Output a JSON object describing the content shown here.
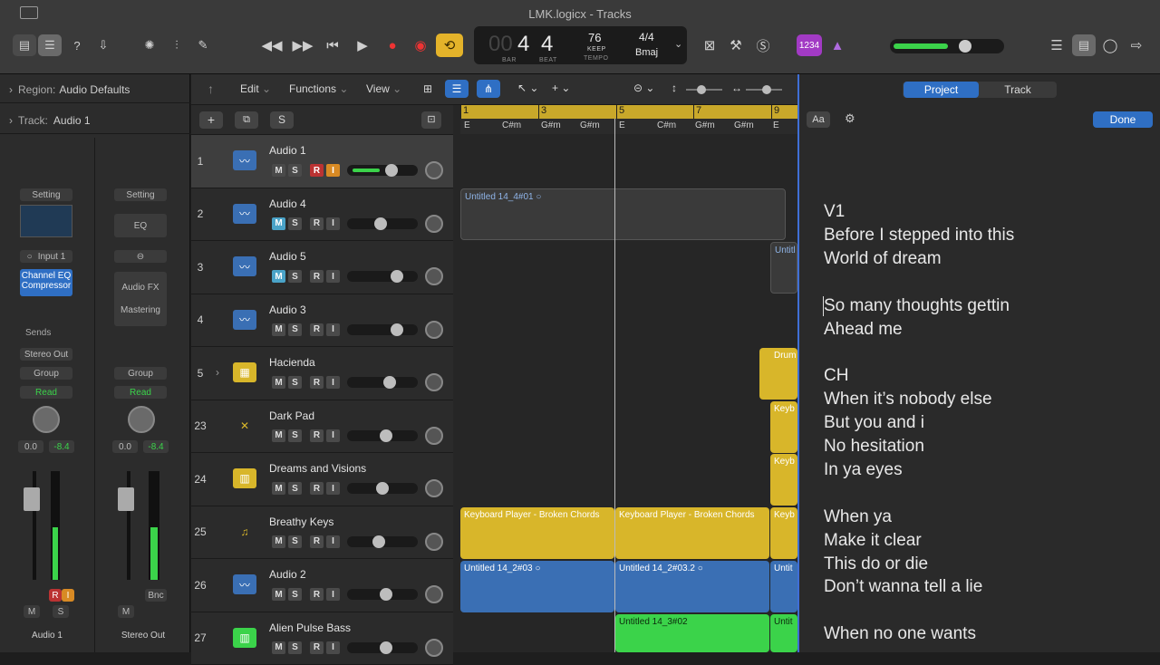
{
  "window": {
    "title": "LMK.logicx - Tracks"
  },
  "lcd": {
    "bar": "4",
    "beat": "4",
    "bar_label": "BAR",
    "beat_label": "BEAT",
    "tempo": "76",
    "keep_label": "KEEP",
    "tempo_label": "TEMPO",
    "signature": "4/4",
    "key": "Bmaj",
    "prefix": "00"
  },
  "toolbar": {
    "count_in": "1234"
  },
  "inspector": {
    "region_label": "Region:",
    "region_value": "Audio Defaults",
    "track_label": "Track:",
    "track_value": "Audio 1",
    "strip1": {
      "setting": "Setting",
      "input": "Input 1",
      "plugin1": "Channel EQ",
      "plugin2": "Compressor",
      "sends": "Sends",
      "output": "Stereo Out",
      "group": "Group",
      "automation": "Read",
      "vol": "0.0",
      "peak": "-8.4",
      "name": "Audio 1",
      "m": "M",
      "s": "S",
      "r": "R",
      "i": "I"
    },
    "strip2": {
      "setting": "Setting",
      "eq": "EQ",
      "fx": "Audio FX",
      "mastering": "Mastering",
      "group": "Group",
      "automation": "Read",
      "vol": "0.0",
      "peak": "-8.4",
      "name": "Stereo Out",
      "m": "M",
      "bnc": "Bnc"
    }
  },
  "arrange_toolbar": {
    "edit": "Edit",
    "functions": "Functions",
    "view": "View",
    "s_btn": "S"
  },
  "ruler": {
    "bars": [
      "1",
      "3",
      "5",
      "7",
      "9"
    ],
    "chords": [
      "E",
      "C#m",
      "G#m",
      "G#m",
      "E",
      "C#m",
      "G#m",
      "G#m",
      "E"
    ]
  },
  "tracks": [
    {
      "num": "1",
      "name": "Audio 1",
      "m": "M",
      "s": "S",
      "r": "R",
      "i": "I"
    },
    {
      "num": "2",
      "name": "Audio 4",
      "m": "M",
      "s": "S",
      "r": "R",
      "i": "I"
    },
    {
      "num": "3",
      "name": "Audio 5",
      "m": "M",
      "s": "S",
      "r": "R",
      "i": "I"
    },
    {
      "num": "4",
      "name": "Audio 3",
      "m": "M",
      "s": "S",
      "r": "R",
      "i": "I"
    },
    {
      "num": "5",
      "name": "Hacienda",
      "m": "M",
      "s": "S",
      "r": "R",
      "i": "I"
    },
    {
      "num": "23",
      "name": "Dark Pad",
      "m": "M",
      "s": "S",
      "r": "R",
      "i": "I"
    },
    {
      "num": "24",
      "name": "Dreams and Visions",
      "m": "M",
      "s": "S",
      "r": "R",
      "i": "I"
    },
    {
      "num": "25",
      "name": "Breathy Keys",
      "m": "M",
      "s": "S",
      "r": "R",
      "i": "I"
    },
    {
      "num": "26",
      "name": "Audio 2",
      "m": "M",
      "s": "S",
      "r": "R",
      "i": "I"
    },
    {
      "num": "27",
      "name": "Alien Pulse Bass",
      "m": "M",
      "s": "S",
      "r": "R",
      "i": "I"
    }
  ],
  "regions": {
    "r2": "Untitled 14_4#01",
    "r3": "Untitl",
    "r5": "Drum",
    "r23": "Keyb",
    "r24": "Keyb",
    "r25a": "Keyboard Player - Broken Chords",
    "r25b": "Keyboard Player - Broken Chords",
    "r25c": "Keyb",
    "r26a": "Untitled 14_2#03",
    "r26b": "Untitled 14_2#03.2",
    "r26c": "Untit",
    "r27a": "Untitled 14_3#02",
    "r27b": "Untit"
  },
  "lyrics_panel": {
    "tab_project": "Project",
    "tab_track": "Track",
    "font_btn": "Aa",
    "done": "Done",
    "lines": [
      "V1",
      "Before I stepped into this",
      "World of dream",
      "",
      "So many thoughts gettin",
      "Ahead me",
      "",
      "CH",
      "When it’s nobody else",
      "But you and i",
      "No hesitation",
      "In ya eyes",
      "",
      "When ya",
      "Make it clear",
      "This do or die",
      "Don’t wanna tell a lie",
      "",
      "When no one wants"
    ]
  },
  "colors": {
    "accent": "#3f6fd6",
    "gold": "#e4b32a",
    "region_yellow": "#d8b62a",
    "region_blue": "#3a6fb4",
    "region_green": "#3bd34a"
  }
}
